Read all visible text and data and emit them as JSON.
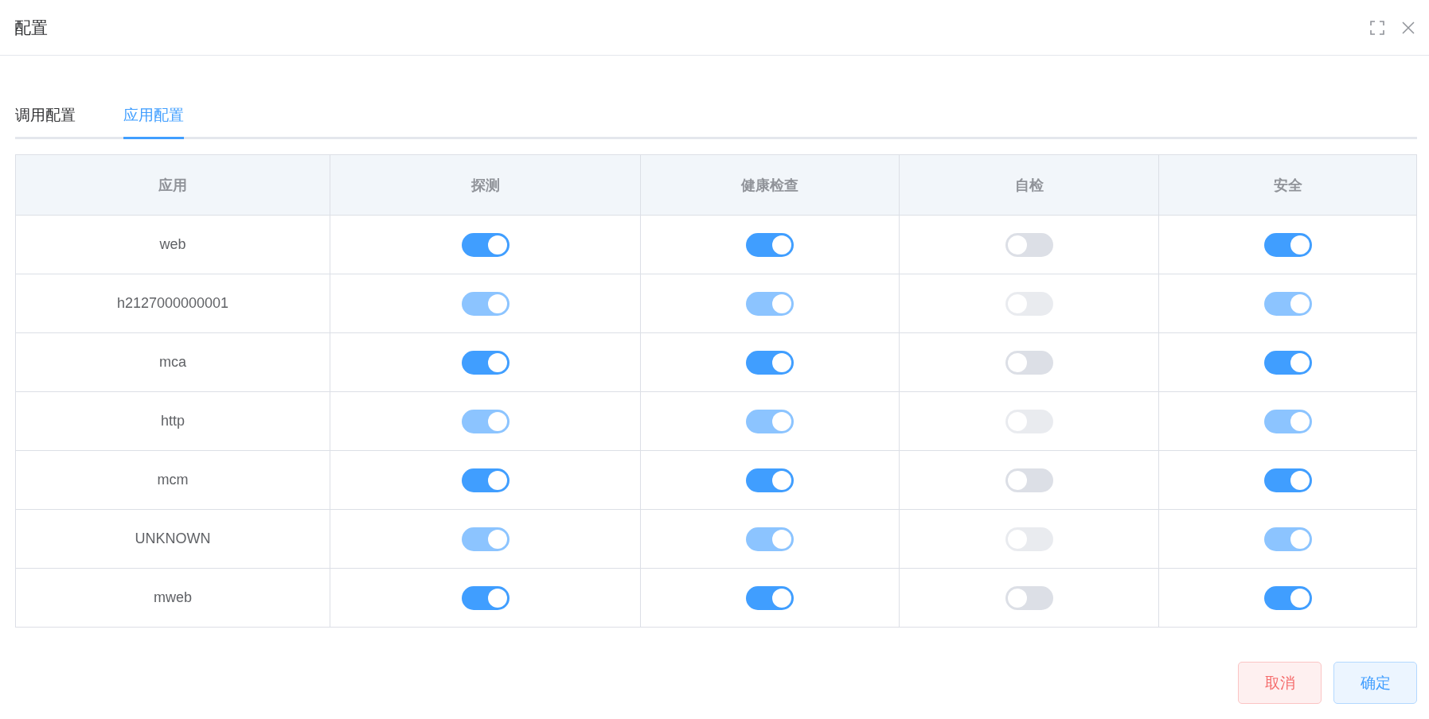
{
  "dialog": {
    "title": "配置"
  },
  "tabs": [
    {
      "label": "调用配置",
      "selected": false
    },
    {
      "label": "应用配置",
      "selected": true
    }
  ],
  "table": {
    "columns": [
      "应用",
      "探测",
      "健康检查",
      "自检",
      "安全"
    ],
    "rows": [
      {
        "app": "web",
        "disabled": false,
        "switches": [
          {
            "on": true
          },
          {
            "on": true
          },
          {
            "on": false
          },
          {
            "on": true
          }
        ]
      },
      {
        "app": "h2127000000001",
        "disabled": true,
        "switches": [
          {
            "on": true
          },
          {
            "on": true
          },
          {
            "on": false
          },
          {
            "on": true
          }
        ]
      },
      {
        "app": "mca",
        "disabled": false,
        "switches": [
          {
            "on": true
          },
          {
            "on": true
          },
          {
            "on": false
          },
          {
            "on": true
          }
        ]
      },
      {
        "app": "http",
        "disabled": true,
        "switches": [
          {
            "on": true
          },
          {
            "on": true
          },
          {
            "on": false
          },
          {
            "on": true
          }
        ]
      },
      {
        "app": "mcm",
        "disabled": false,
        "switches": [
          {
            "on": true
          },
          {
            "on": true
          },
          {
            "on": false
          },
          {
            "on": true
          }
        ]
      },
      {
        "app": "UNKNOWN",
        "disabled": true,
        "switches": [
          {
            "on": true
          },
          {
            "on": true
          },
          {
            "on": false
          },
          {
            "on": true
          }
        ]
      },
      {
        "app": "mweb",
        "disabled": false,
        "switches": [
          {
            "on": true
          },
          {
            "on": true
          },
          {
            "on": false
          },
          {
            "on": true
          }
        ]
      }
    ]
  },
  "buttons": [
    {
      "label": "取消",
      "kind": "cancel"
    },
    {
      "label": "确定",
      "kind": "confirm"
    }
  ]
}
